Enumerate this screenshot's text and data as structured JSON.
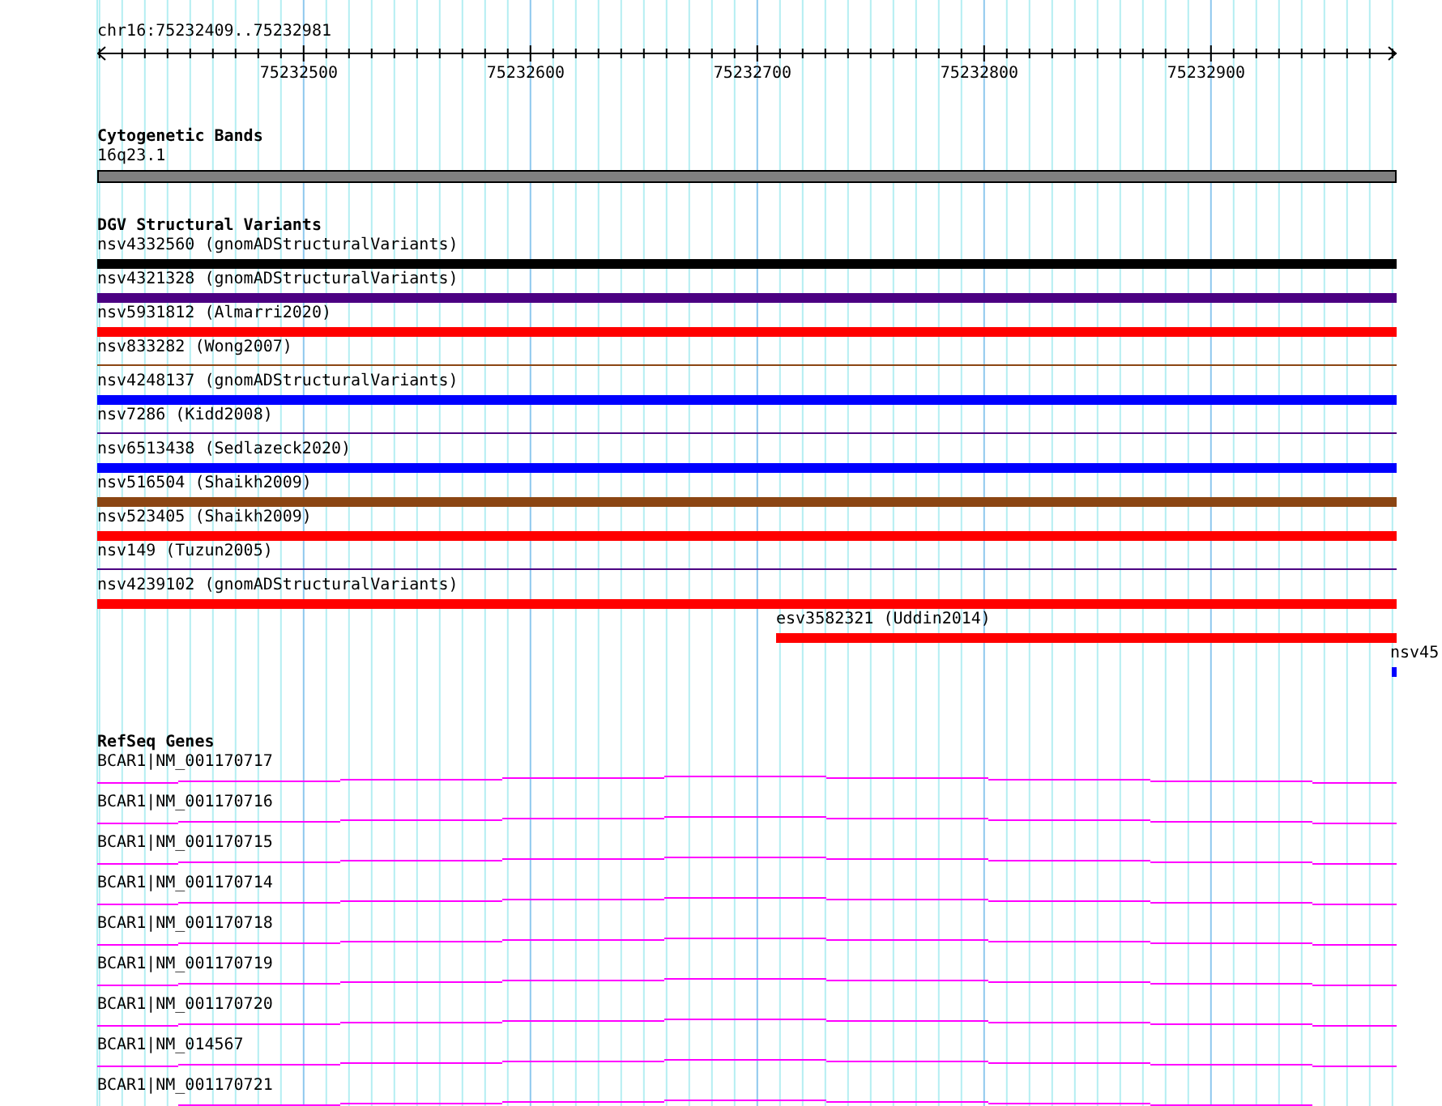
{
  "ruler": {
    "region": "chr16:75232409..75232981",
    "ticks": [
      "75232500",
      "75232600",
      "75232700",
      "75232800",
      "75232900"
    ]
  },
  "cytogenetic_bands": {
    "title": "Cytogenetic Bands",
    "band": "16q23.1"
  },
  "dgv_structural_variants": {
    "title": "DGV Structural Variants",
    "items": [
      {
        "label": "nsv4332560 (gnomADStructuralVariants)",
        "kind": "bar",
        "color": "#000000"
      },
      {
        "label": "nsv4321328 (gnomADStructuralVariants)",
        "kind": "bar",
        "color": "#4b0082"
      },
      {
        "label": "nsv5931812 (Almarri2020)",
        "kind": "bar",
        "color": "#ff0000"
      },
      {
        "label": "nsv833282 (Wong2007)",
        "kind": "line",
        "color": "#8b4513"
      },
      {
        "label": "nsv4248137 (gnomADStructuralVariants)",
        "kind": "bar",
        "color": "#0000ff"
      },
      {
        "label": "nsv7286 (Kidd2008)",
        "kind": "line",
        "color": "#4b0082"
      },
      {
        "label": "nsv6513438 (Sedlazeck2020)",
        "kind": "bar",
        "color": "#0000ff"
      },
      {
        "label": "nsv516504 (Shaikh2009)",
        "kind": "bar",
        "color": "#8b4513"
      },
      {
        "label": "nsv523405 (Shaikh2009)",
        "kind": "bar",
        "color": "#ff0000"
      },
      {
        "label": "nsv149 (Tuzun2005)",
        "kind": "line",
        "color": "#4b0082"
      },
      {
        "label": "nsv4239102 (gnomADStructuralVariants)",
        "kind": "bar",
        "color": "#ff0000"
      },
      {
        "label": "esv3582321 (Uddin2014)",
        "kind": "offset-bar",
        "color": "#ff0000"
      },
      {
        "label": "nsv45",
        "kind": "tick",
        "color": "#0000ff"
      }
    ]
  },
  "refseq_genes": {
    "title": "RefSeq Genes",
    "items": [
      {
        "label": "BCAR1|NM_001170717"
      },
      {
        "label": "BCAR1|NM_001170716"
      },
      {
        "label": "BCAR1|NM_001170715"
      },
      {
        "label": "BCAR1|NM_001170714"
      },
      {
        "label": "BCAR1|NM_001170718"
      },
      {
        "label": "BCAR1|NM_001170719"
      },
      {
        "label": "BCAR1|NM_001170720"
      },
      {
        "label": "BCAR1|NM_014567"
      },
      {
        "label": "BCAR1|NM_001170721"
      }
    ]
  }
}
